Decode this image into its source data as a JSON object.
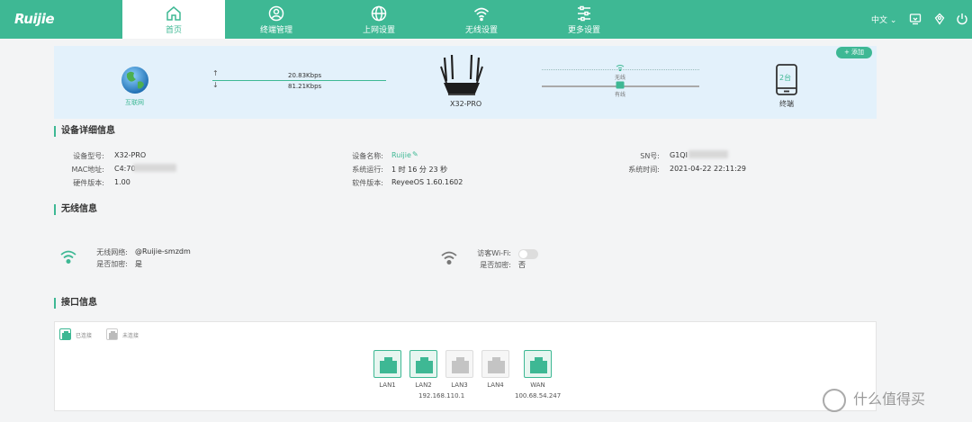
{
  "brand": {
    "logo_text": "Ruijie",
    "accent": "#3eb894"
  },
  "nav": {
    "tabs": [
      {
        "label": "首页",
        "icon": "home-icon",
        "active": true
      },
      {
        "label": "终端管理",
        "icon": "user-icon"
      },
      {
        "label": "上网设置",
        "icon": "globe-icon"
      },
      {
        "label": "无线设置",
        "icon": "wifi-icon"
      },
      {
        "label": "更多设置",
        "icon": "sliders-icon"
      }
    ],
    "language": "中文 ⌄",
    "toolbar_icons": [
      "screen-icon",
      "location-icon",
      "power-icon"
    ]
  },
  "topology": {
    "add_button": "+ 添加",
    "internet_label": "互联网",
    "upload_arrow": "↑",
    "download_arrow": "↓",
    "upload_speed": "20.83Kbps",
    "download_speed": "81.21Kbps",
    "router_label": "X32-PRO",
    "wireless_label": "无线",
    "wired_label": "有线",
    "terminal_count": "2台",
    "terminal_label": "终端"
  },
  "device_info": {
    "title": "设备详细信息",
    "model_label": "设备型号:",
    "model_value": "X32-PRO",
    "mac_label": "MAC地址:",
    "mac_value": "C4:70",
    "hw_label": "硬件版本:",
    "hw_value": "1.00",
    "name_label": "设备名称:",
    "name_value": "Ruijie",
    "edit_glyph": "✎",
    "uptime_label": "系统运行:",
    "uptime_value": "1 时 16 分 23 秒",
    "sw_label": "软件版本:",
    "sw_value": "ReyeeOS 1.60.1602",
    "sn_label": "SN号:",
    "sn_value": "G1QI",
    "time_label": "系统时间:",
    "time_value": "2021-04-22 22:11:29"
  },
  "wireless_info": {
    "title": "无线信息",
    "ssid_label": "无线网络:",
    "ssid_value": "@Ruijie-smzdm",
    "encrypt_label": "是否加密:",
    "encrypt_value": "是",
    "guest_label": "访客Wi-Fi:",
    "guest_enabled": false,
    "guest_encrypt_label": "是否加密:",
    "guest_encrypt_value": "否"
  },
  "interface_info": {
    "title": "接口信息",
    "legend_connected": "已连接",
    "legend_disconnected": "未连接",
    "ports": [
      {
        "name": "LAN1",
        "connected": true
      },
      {
        "name": "LAN2",
        "connected": true
      },
      {
        "name": "LAN3",
        "connected": false
      },
      {
        "name": "LAN4",
        "connected": false
      },
      {
        "name": "WAN",
        "connected": true
      }
    ],
    "lan_ip": "192.168.110.1",
    "wan_ip": "100.68.54.247"
  },
  "watermark": "什么值得买"
}
